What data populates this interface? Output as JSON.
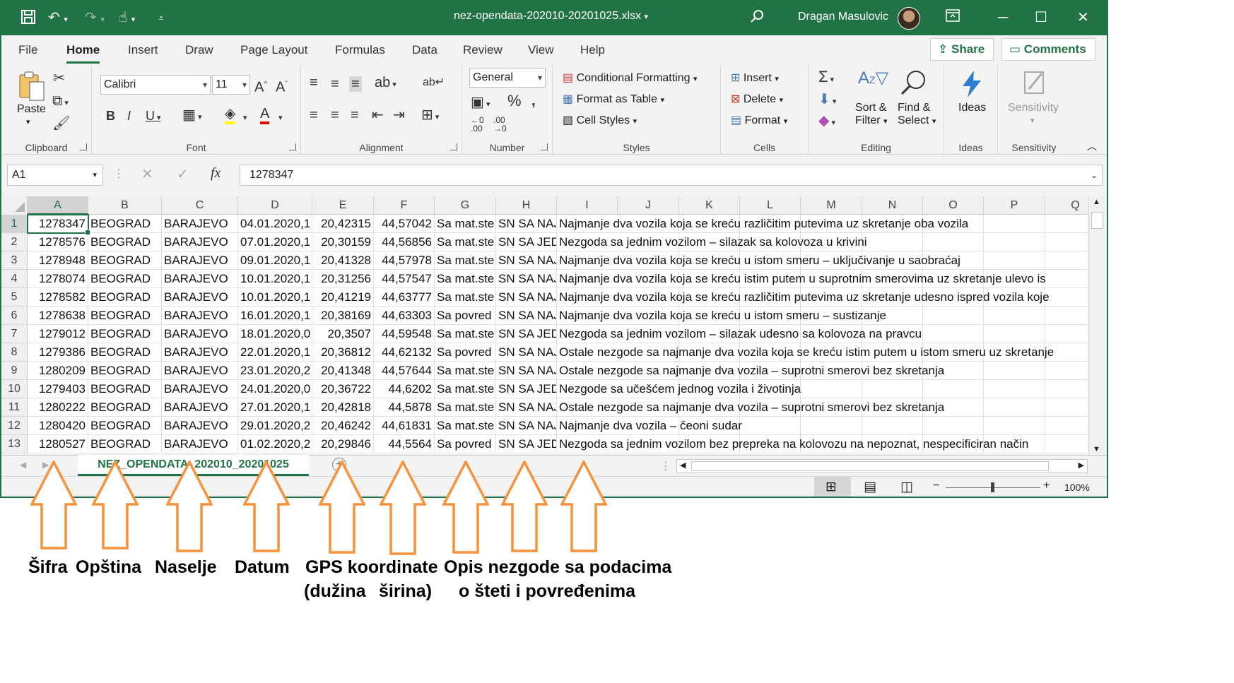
{
  "titlebar": {
    "file_name": "nez-opendata-202010-20201025.xlsx",
    "user_name": "Dragan Masulovic"
  },
  "menu": {
    "tabs": [
      "File",
      "Home",
      "Insert",
      "Draw",
      "Page Layout",
      "Formulas",
      "Data",
      "Review",
      "View",
      "Help"
    ],
    "active": "Home",
    "share": "Share",
    "comments": "Comments"
  },
  "ribbon": {
    "clipboard": {
      "paste": "Paste",
      "label": "Clipboard"
    },
    "font": {
      "name": "Calibri",
      "size": "11",
      "label": "Font"
    },
    "alignment": {
      "label": "Alignment"
    },
    "number": {
      "format": "General",
      "label": "Number"
    },
    "styles": {
      "conditional": "Conditional Formatting",
      "table": "Format as Table",
      "cell_styles": "Cell Styles",
      "label": "Styles"
    },
    "cells": {
      "insert": "Insert",
      "delete": "Delete",
      "format": "Format",
      "label": "Cells"
    },
    "editing": {
      "sort1": "Sort &",
      "sort2": "Filter",
      "find1": "Find &",
      "find2": "Select",
      "label": "Editing"
    },
    "ideas": {
      "button": "Ideas",
      "label": "Ideas"
    },
    "sensitivity": {
      "button": "Sensitivity",
      "label": "Sensitivity"
    }
  },
  "formula_bar": {
    "name_box": "A1",
    "value": "1278347"
  },
  "columns": [
    "A",
    "B",
    "C",
    "D",
    "E",
    "F",
    "G",
    "H",
    "I",
    "J",
    "K",
    "L",
    "M",
    "N",
    "O",
    "P",
    "Q"
  ],
  "rows": [
    {
      "n": "1",
      "A": "1278347",
      "B": "BEOGRAD",
      "C": "BARAJEVO",
      "D": "04.01.2020,1",
      "E": "20,42315",
      "F": "44,57042",
      "G": "Sa mat.ste",
      "H": "SN SA NAJ",
      "I": "Najmanje dva vozila koja se kreću različitim putevima uz skretanje oba vozila"
    },
    {
      "n": "2",
      "A": "1278576",
      "B": "BEOGRAD",
      "C": "BARAJEVO",
      "D": "07.01.2020,1",
      "E": "20,30159",
      "F": "44,56856",
      "G": "Sa mat.ste",
      "H": "SN SA JEDI",
      "I": "Nezgoda sa jednim vozilom – silazak sa kolovoza u krivini"
    },
    {
      "n": "3",
      "A": "1278948",
      "B": "BEOGRAD",
      "C": "BARAJEVO",
      "D": "09.01.2020,1",
      "E": "20,41328",
      "F": "44,57978",
      "G": "Sa mat.ste",
      "H": "SN SA NAJ",
      "I": "Najmanje dva vozila koja se kreću u istom smeru – uključivanje u saobraćaj"
    },
    {
      "n": "4",
      "A": "1278074",
      "B": "BEOGRAD",
      "C": "BARAJEVO",
      "D": "10.01.2020,1",
      "E": "20,31256",
      "F": "44,57547",
      "G": "Sa mat.ste",
      "H": "SN SA NAJ",
      "I": "Najmanje dva vozila koja se kreću istim putem u suprotnim smerovima uz skretanje ulevo is"
    },
    {
      "n": "5",
      "A": "1278582",
      "B": "BEOGRAD",
      "C": "BARAJEVO",
      "D": "10.01.2020,1",
      "E": "20,41219",
      "F": "44,63777",
      "G": "Sa mat.ste",
      "H": "SN SA NAJ",
      "I": "Najmanje dva vozila koja se kreću različitim putevima uz skretanje udesno ispred vozila koje"
    },
    {
      "n": "6",
      "A": "1278638",
      "B": "BEOGRAD",
      "C": "BARAJEVO",
      "D": "16.01.2020,1",
      "E": "20,38169",
      "F": "44,63303",
      "G": "Sa povred",
      "H": "SN SA NAJ",
      "I": "Najmanje dva vozila koja se kreću u istom smeru – sustizanje"
    },
    {
      "n": "7",
      "A": "1279012",
      "B": "BEOGRAD",
      "C": "BARAJEVO",
      "D": "18.01.2020,0",
      "E": "20,3507",
      "F": "44,59548",
      "G": "Sa mat.ste",
      "H": "SN SA JEDI",
      "I": "Nezgoda sa jednim vozilom – silazak udesno sa kolovoza na pravcu"
    },
    {
      "n": "8",
      "A": "1279386",
      "B": "BEOGRAD",
      "C": "BARAJEVO",
      "D": "22.01.2020,1",
      "E": "20,36812",
      "F": "44,62132",
      "G": "Sa povred",
      "H": "SN SA NAJ",
      "I": "Ostale nezgode sa najmanje dva vozila koja se kreću istim putem u istom smeru uz skretanje"
    },
    {
      "n": "9",
      "A": "1280209",
      "B": "BEOGRAD",
      "C": "BARAJEVO",
      "D": "23.01.2020,2",
      "E": "20,41348",
      "F": "44,57644",
      "G": "Sa mat.ste",
      "H": "SN SA NAJ",
      "I": "Ostale nezgode sa najmanje dva vozila – suprotni smerovi bez skretanja"
    },
    {
      "n": "10",
      "A": "1279403",
      "B": "BEOGRAD",
      "C": "BARAJEVO",
      "D": "24.01.2020,0",
      "E": "20,36722",
      "F": "44,6202",
      "G": "Sa mat.ste",
      "H": "SN SA JEDI",
      "I": "Nezgode sa učešćem jednog vozila i životinja"
    },
    {
      "n": "11",
      "A": "1280222",
      "B": "BEOGRAD",
      "C": "BARAJEVO",
      "D": "27.01.2020,1",
      "E": "20,42818",
      "F": "44,5878",
      "G": "Sa mat.ste",
      "H": "SN SA NAJ",
      "I": "Ostale nezgode sa najmanje dva vozila – suprotni smerovi bez skretanja"
    },
    {
      "n": "12",
      "A": "1280420",
      "B": "BEOGRAD",
      "C": "BARAJEVO",
      "D": "29.01.2020,2",
      "E": "20,46242",
      "F": "44,61831",
      "G": "Sa mat.ste",
      "H": "SN SA NAJ",
      "I": "Najmanje dva vozila – čeoni sudar"
    },
    {
      "n": "13",
      "A": "1280527",
      "B": "BEOGRAD",
      "C": "BARAJEVO",
      "D": "01.02.2020,2",
      "E": "20,29846",
      "F": "44,5564",
      "G": "Sa povred",
      "H": "SN SA JEDI",
      "I": "Nezgoda sa jednim vozilom bez prepreka na kolovozu na nepoznat, nespecificiran način"
    }
  ],
  "sheet_tab": "NEZ_OPENDATA_202010_20201025",
  "zoom": "100%",
  "annotations": {
    "sifra": "Šifra",
    "opstina": "Opština",
    "naselje": "Naselje",
    "datum": "Datum",
    "gps": "GPS koordinate",
    "duzina": "(dužina",
    "sirina": "širina)",
    "opis": "Opis nezgode sa podacima",
    "steta": "o šteti i povređenima"
  },
  "colors": {
    "excel_green": "#217346",
    "arrow_orange": "#f7913a"
  }
}
